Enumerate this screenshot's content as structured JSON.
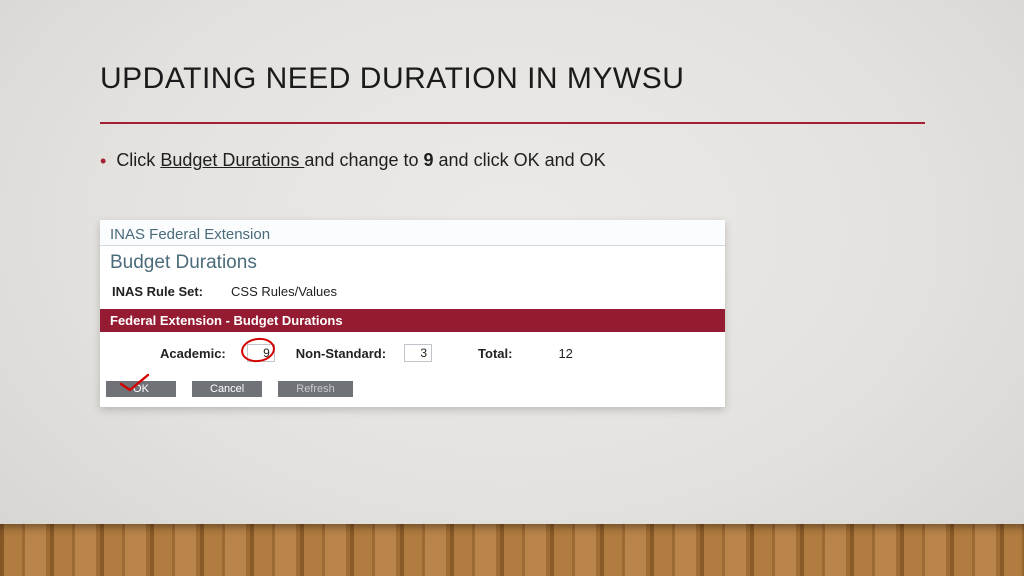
{
  "slide": {
    "title": "UPDATING NEED DURATION IN MYWSU",
    "bullet_prefix": "Click ",
    "bullet_underlined": "Budget Durations ",
    "bullet_mid": "and change to ",
    "bullet_bold": "9",
    "bullet_suffix": " and click OK and OK"
  },
  "shot": {
    "topline": "INAS Federal Extension",
    "heading": "Budget Durations",
    "rule_label": "INAS Rule Set:",
    "rule_value": "CSS Rules/Values",
    "band": "Federal Extension - Budget Durations",
    "academic_label": "Academic:",
    "academic_value": "9",
    "nonstd_label": "Non-Standard:",
    "nonstd_value": "3",
    "total_label": "Total:",
    "total_value": "12",
    "buttons": {
      "ok": "OK",
      "cancel": "Cancel",
      "refresh": "Refresh"
    }
  }
}
